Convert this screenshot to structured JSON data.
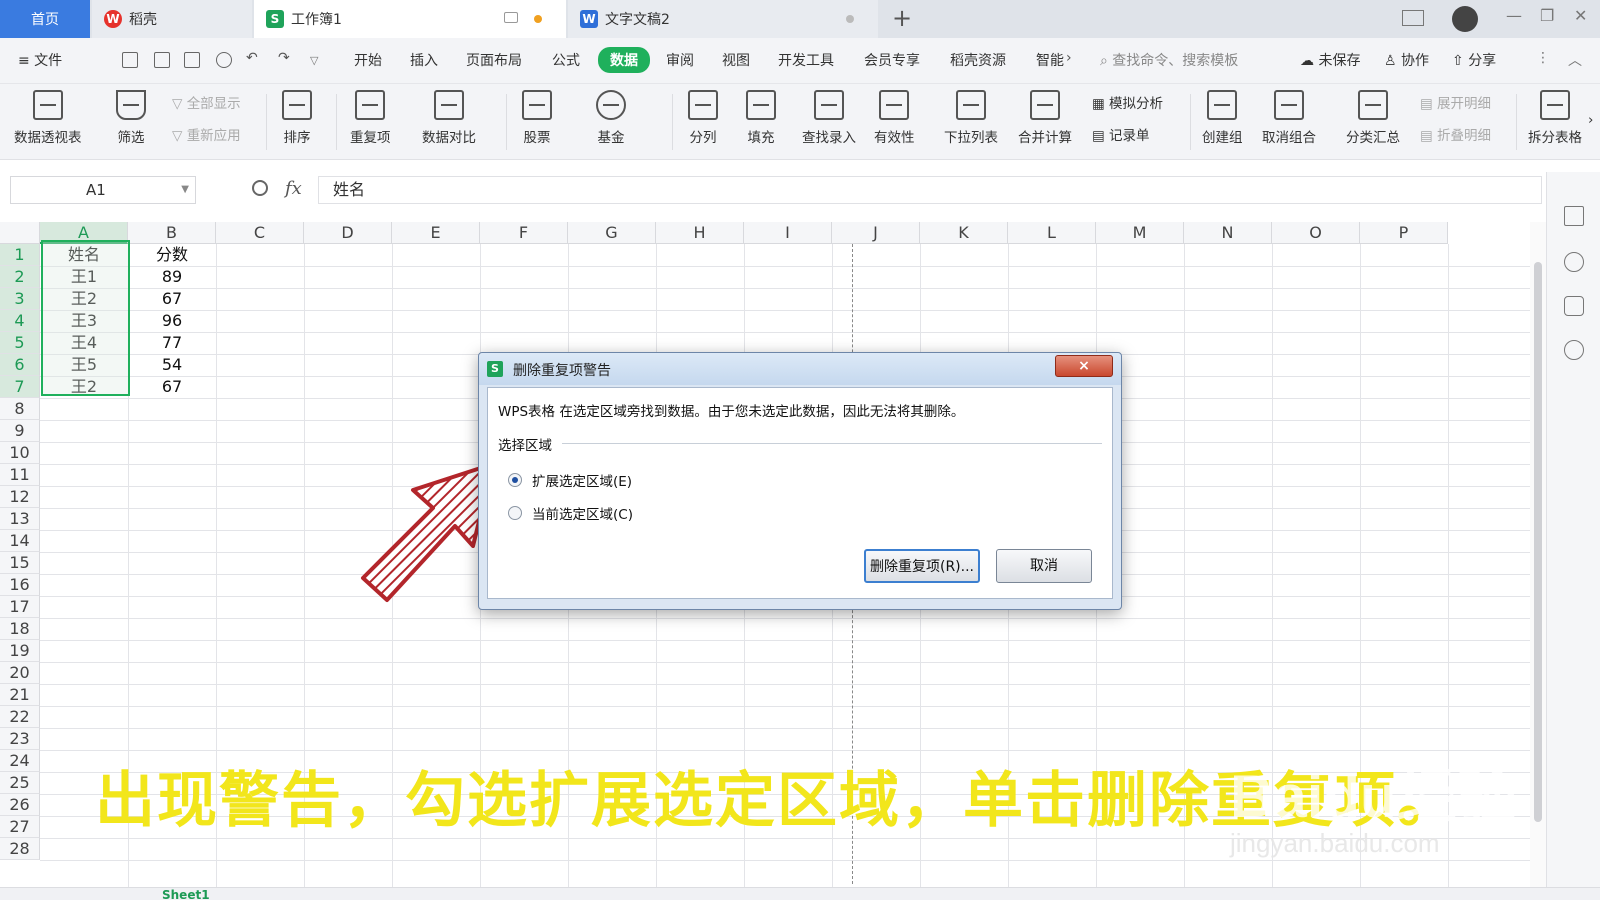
{
  "tabs": {
    "home": "首页",
    "daoke": "稻壳",
    "workbook": "工作簿1",
    "doc": "文字文稿2",
    "new_tab": "+"
  },
  "menu": {
    "file": "≡ 文件",
    "items": [
      "开始",
      "插入",
      "页面布局",
      "公式",
      "数据",
      "审阅",
      "视图",
      "开发工具",
      "会员专享",
      "稻壳资源",
      "智能"
    ],
    "active": "数据",
    "search_placeholder": "查找命令、搜索模板",
    "unsaved": "未保存",
    "collab": "协作",
    "share": "分享"
  },
  "ribbon": {
    "pivot": "数据透视表",
    "filter": "筛选",
    "show_all": "全部显示",
    "reapply": "重新应用",
    "sort": "排序",
    "dup": "重复项",
    "compare": "数据对比",
    "stock": "股票",
    "fund": "基金",
    "split": "分列",
    "fill": "填充",
    "lookup": "查找录入",
    "validity": "有效性",
    "dropdown": "下拉列表",
    "merge_calc": "合并计算",
    "simulate": "模拟分析",
    "record": "记录单",
    "group": "创建组",
    "ungroup": "取消组合",
    "subtotal": "分类汇总",
    "expand": "展开明细",
    "collapse": "折叠明细",
    "split_table": "拆分表格"
  },
  "formula_bar": {
    "cell_ref": "A1",
    "fx": "fx",
    "content": "姓名"
  },
  "sheet": {
    "columns": [
      "A",
      "B",
      "C",
      "D",
      "E",
      "F",
      "G",
      "H",
      "I",
      "J",
      "K",
      "L",
      "M",
      "N",
      "O",
      "P"
    ],
    "rows": [
      "1",
      "2",
      "3",
      "4",
      "5",
      "6",
      "7",
      "8",
      "9",
      "10",
      "11",
      "12",
      "13",
      "14",
      "15",
      "16",
      "17",
      "18",
      "19",
      "20",
      "21",
      "22",
      "23",
      "24",
      "25",
      "26",
      "27",
      "28"
    ],
    "data": [
      [
        "姓名",
        "分数"
      ],
      [
        "王1",
        "89"
      ],
      [
        "王2",
        "67"
      ],
      [
        "王3",
        "96"
      ],
      [
        "王4",
        "77"
      ],
      [
        "王5",
        "54"
      ],
      [
        "王2",
        "67"
      ]
    ],
    "sheet_tab": "Sheet1"
  },
  "dialog": {
    "title": "删除重复项警告",
    "message": "WPS表格 在选定区域旁找到数据。由于您未选定此数据，因此无法将其删除。",
    "group_label": "选择区域",
    "option_expand": "扩展选定区域(E)",
    "option_current": "当前选定区域(C)",
    "selected_option": "expand",
    "btn_remove": "删除重复项(R)...",
    "btn_cancel": "取消",
    "close": "×"
  },
  "caption": "出现警告，勾选扩展选定区域，单击删除重复项。",
  "watermark": "Baidu经验",
  "watermark_url": "jingyan.baidu.com",
  "colors": {
    "accent_green": "#1fb05c",
    "home_tab": "#3a7be0",
    "caption_yellow": "#f2e61b",
    "arrow_red": "#b3262b"
  }
}
